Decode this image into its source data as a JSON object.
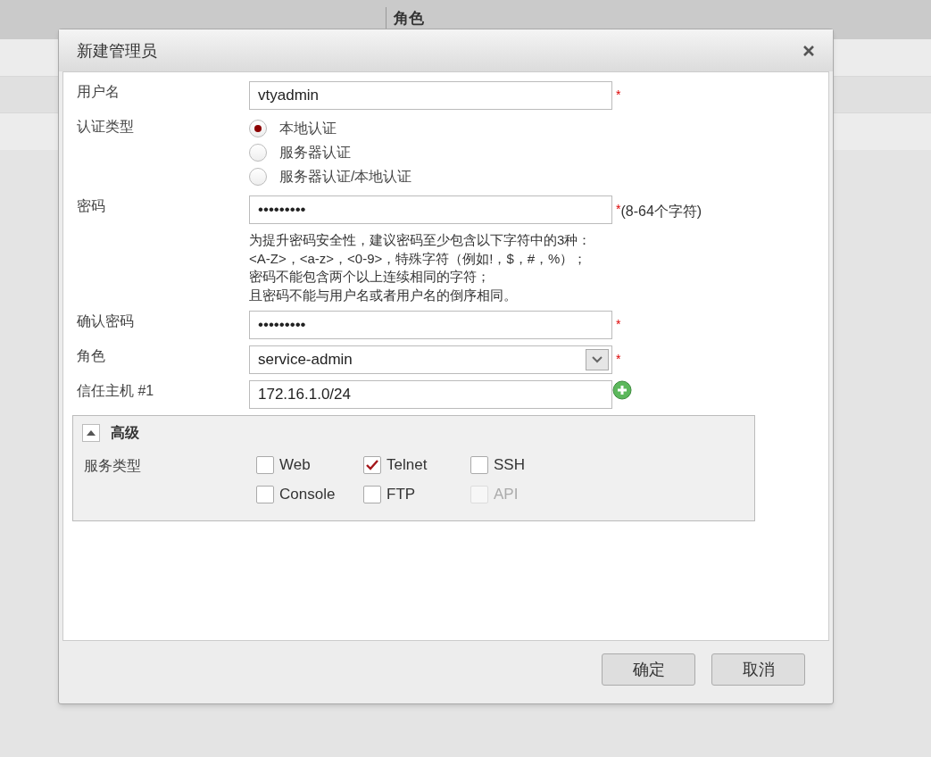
{
  "background": {
    "column_header": "角色"
  },
  "dialog": {
    "title": "新建管理员",
    "fields": [
      {
        "kind": "text",
        "label": "用户名",
        "value": "vtyadmin",
        "mark": "*"
      },
      {
        "kind": "radio",
        "label": "认证类型",
        "options": [
          {
            "label": "本地认证",
            "selected": true
          },
          {
            "label": "服务器认证",
            "selected": false
          },
          {
            "label": "服务器认证/本地认证",
            "selected": false
          }
        ]
      },
      {
        "kind": "text",
        "label": "密码",
        "value": "•••••••••",
        "mark": "*",
        "note": "(8-64个字符)",
        "hint": [
          "为提升密码安全性，建议密码至少包含以下字符中的3种：",
          "<A-Z>，<a-z>，<0-9>，特殊字符（例如!，$，#，%）；",
          "密码不能包含两个以上连续相同的字符；",
          "且密码不能与用户名或者用户名的倒序相同。"
        ]
      },
      {
        "kind": "text",
        "label": "确认密码",
        "value": "•••••••••",
        "mark": "*"
      },
      {
        "kind": "select",
        "label": "角色",
        "value": "service-admin",
        "mark": "*"
      },
      {
        "kind": "text",
        "label": "信任主机 #1",
        "value": "172.16.1.0/24",
        "add": true
      }
    ],
    "advanced": {
      "title": "高级",
      "expanded": true,
      "label": "服务类型",
      "services": [
        {
          "label": "Web",
          "checked": false,
          "disabled": false
        },
        {
          "label": "Telnet",
          "checked": true,
          "disabled": false
        },
        {
          "label": "SSH",
          "checked": false,
          "disabled": false
        },
        {
          "label": "Console",
          "checked": false,
          "disabled": false
        },
        {
          "label": "FTP",
          "checked": false,
          "disabled": false
        },
        {
          "label": "API",
          "checked": false,
          "disabled": true
        }
      ]
    },
    "buttons": [
      "确定",
      "取消"
    ]
  }
}
